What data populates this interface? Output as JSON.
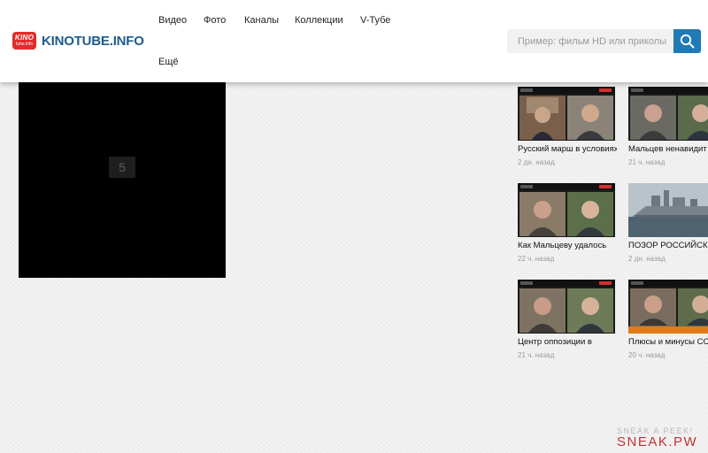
{
  "site": {
    "logo_badge_top": "KINO",
    "logo_badge_bottom": "tube.info",
    "logo_text": "KINOTUBE.INFO"
  },
  "nav": {
    "items": [
      "Видео",
      "Фото",
      "Каналы",
      "Коллекции",
      "V-Тубе",
      "Ещё"
    ]
  },
  "search": {
    "placeholder": "Пример: фильм HD или приколы",
    "icon": "search-icon"
  },
  "player": {
    "countdown": "5"
  },
  "related": [
    {
      "title": "Русский марш в условиях",
      "time": "2 дн. назад",
      "thumb": "two-men-video-call"
    },
    {
      "title": "Мальцев ненавидит",
      "time": "21 ч. назад",
      "thumb": "two-men-video-call"
    },
    {
      "title": "Как Мальцеву удалось",
      "time": "22 ч. назад",
      "thumb": "two-men-video-call"
    },
    {
      "title": "ПОЗОР РОССИЙСК",
      "time": "2 дн. назад",
      "thumb": "warship-at-sea"
    },
    {
      "title": "Центр оппозиции в",
      "time": "21 ч. назад",
      "thumb": "two-men-video-call"
    },
    {
      "title": "Плюсы и минусы ССС",
      "time": "20 ч. назад",
      "thumb": "two-men-video-call"
    }
  ],
  "watermark": {
    "line1": "SNEAK A PEEK!",
    "line2": "SNEAK.PW"
  },
  "colors": {
    "brand_red": "#e32b2b",
    "brand_blue": "#1e5c8e",
    "search_button": "#1f7ab8",
    "live_badge": "#d32f2f"
  }
}
